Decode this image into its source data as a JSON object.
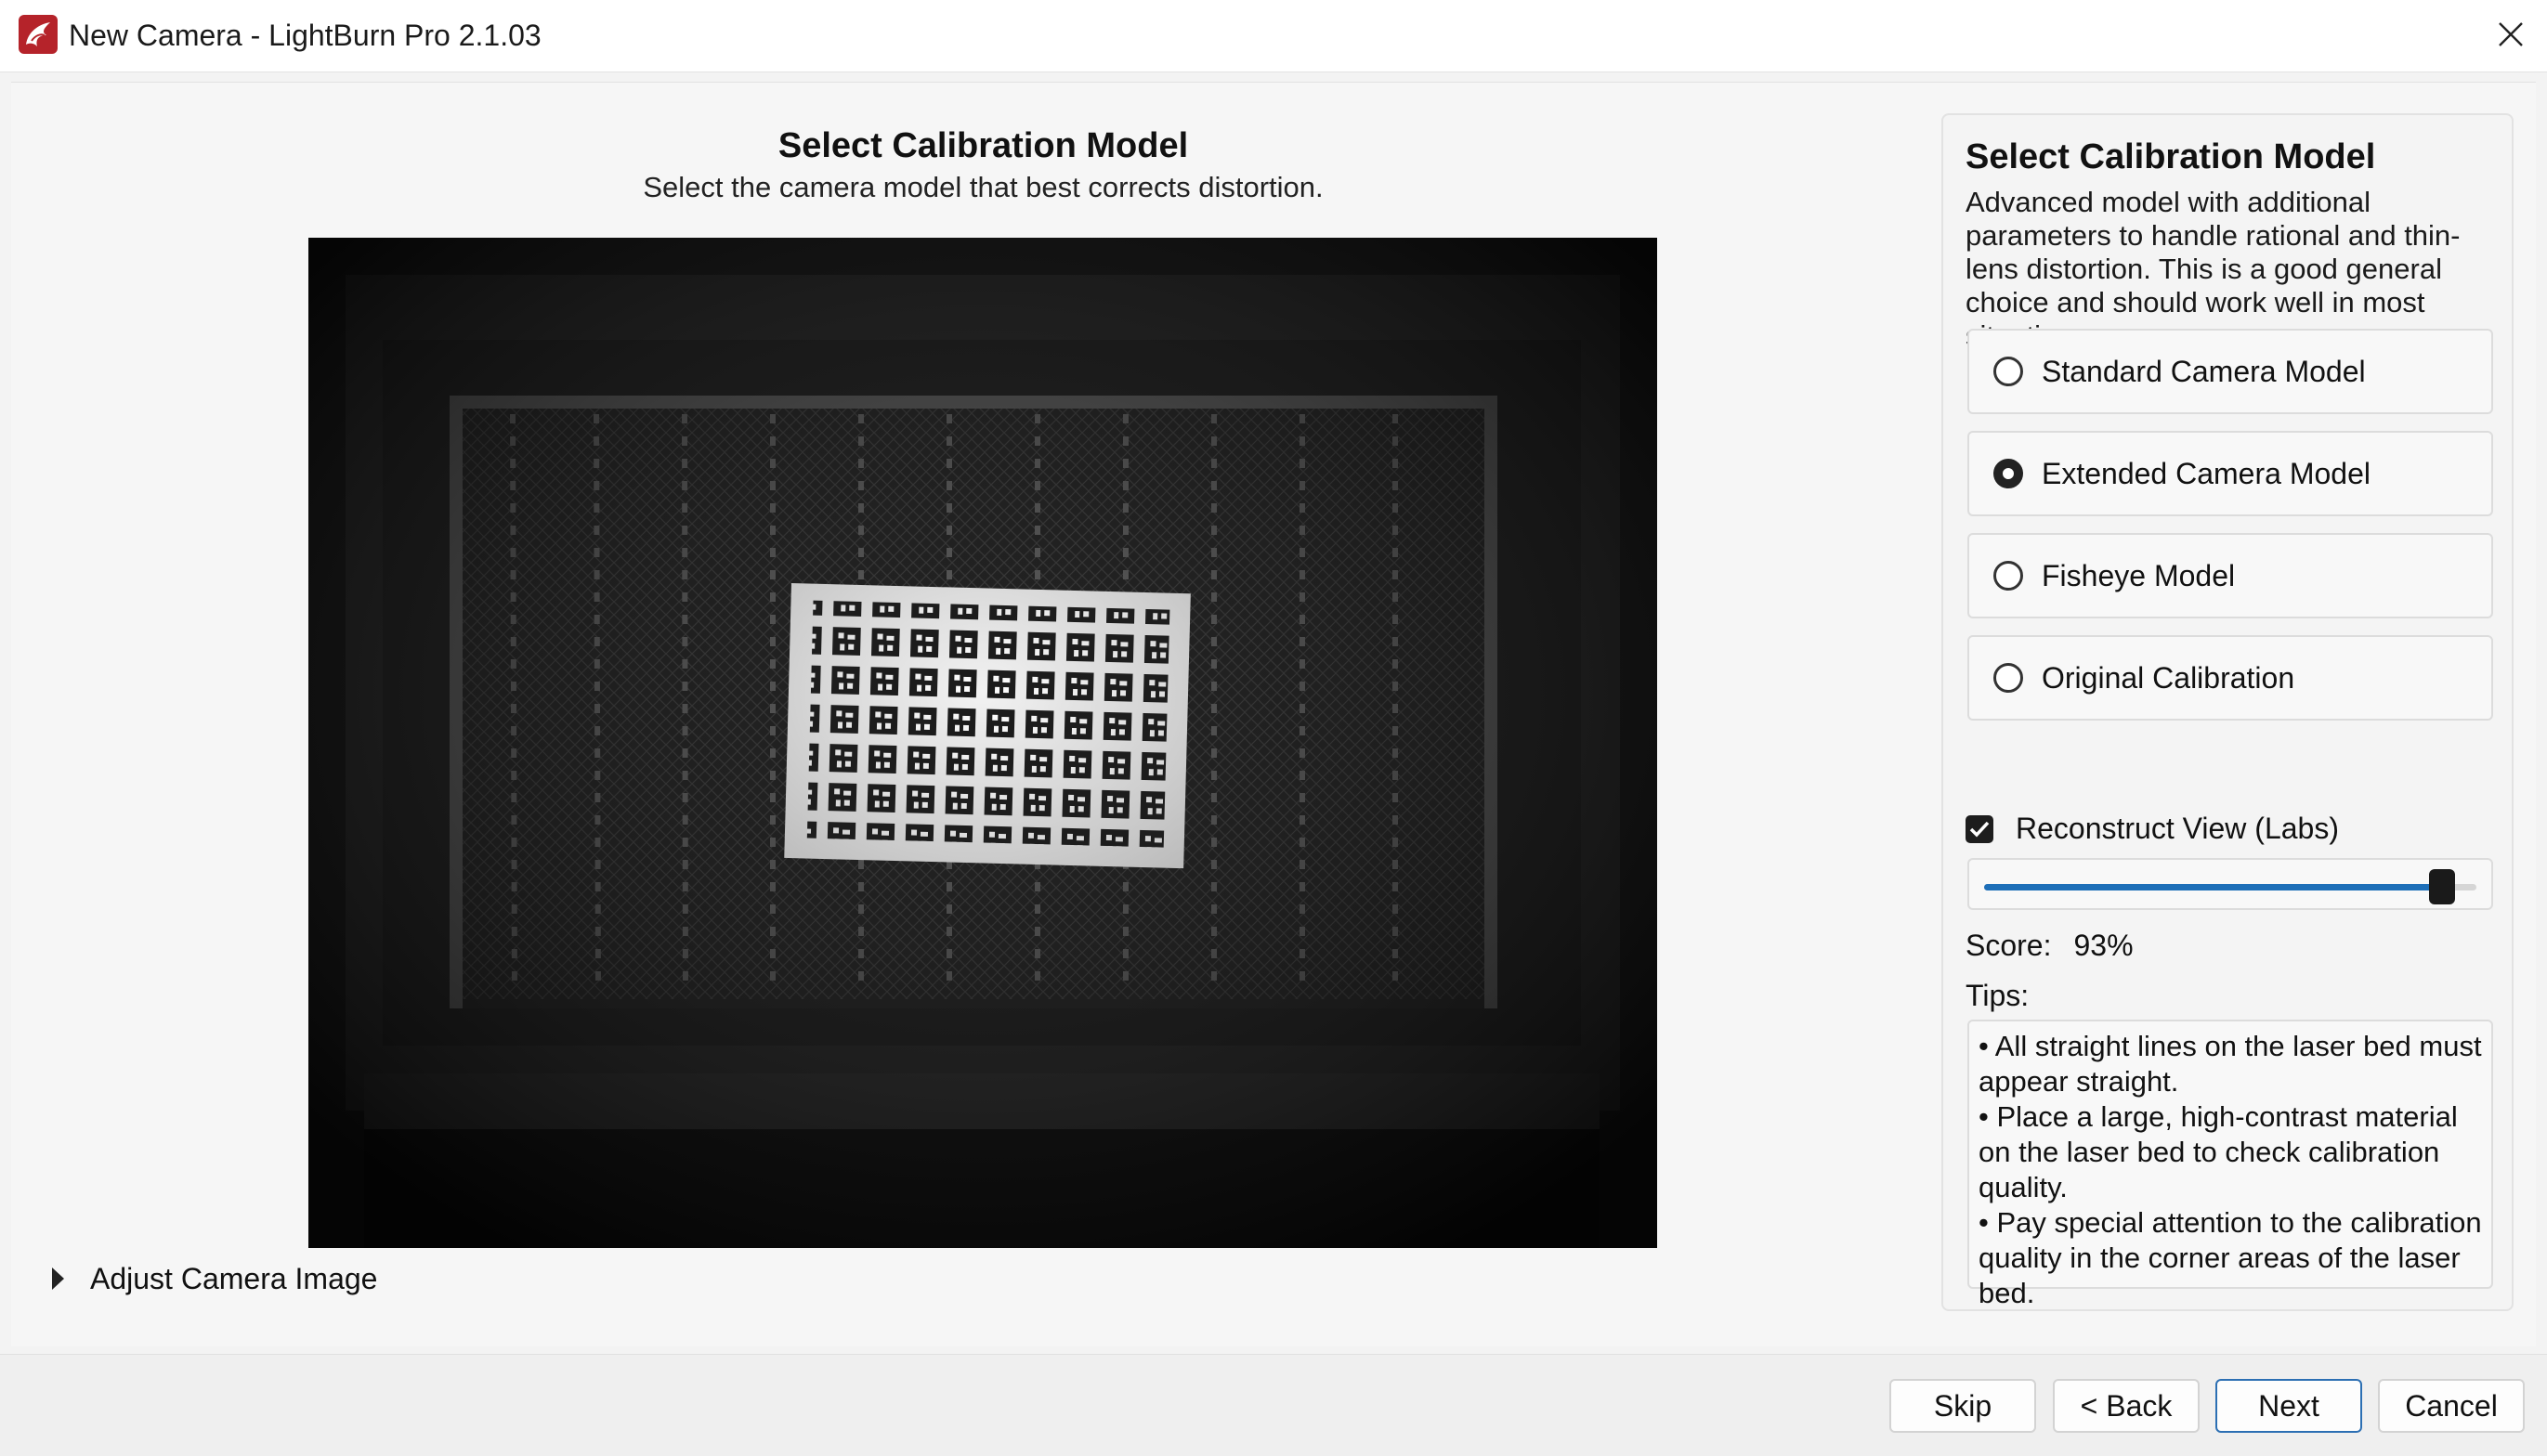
{
  "window": {
    "title": "New Camera - LightBurn Pro 2.1.03",
    "icon": "lightburn-app-icon",
    "close_icon": "close-icon"
  },
  "main": {
    "title": "Select Calibration Model",
    "subtitle": "Select the camera model that best corrects distortion.",
    "camera_image_alt": "camera-preview-image",
    "adjust_label": "Adjust Camera Image"
  },
  "panel": {
    "title": "Select Calibration Model",
    "description": "Advanced model with additional parameters to handle rational and thin-lens distortion. This is a good general choice and should work well in most situations.",
    "options": [
      {
        "label": "Standard Camera Model",
        "checked": false
      },
      {
        "label": "Extended Camera Model",
        "checked": true
      },
      {
        "label": "Fisheye Model",
        "checked": false
      },
      {
        "label": "Original Calibration",
        "checked": false
      }
    ],
    "reconstruct_label": "Reconstruct View (Labs)",
    "reconstruct_checked": true,
    "slider_value": 0.93,
    "score_label": "Score:",
    "score_value": "93%",
    "tips_label": "Tips:",
    "tips": [
      "• All straight lines on the laser bed must appear straight.",
      "• Place a large, high-contrast material on the laser bed to check calibration quality.",
      "• Pay special attention to the calibration quality in the corner areas of the laser bed."
    ]
  },
  "footer": {
    "skip": "Skip",
    "back": "< Back",
    "next": "Next",
    "cancel": "Cancel"
  },
  "colors": {
    "accent": "#1e6fb8",
    "primary_border": "#2c6fb3"
  }
}
